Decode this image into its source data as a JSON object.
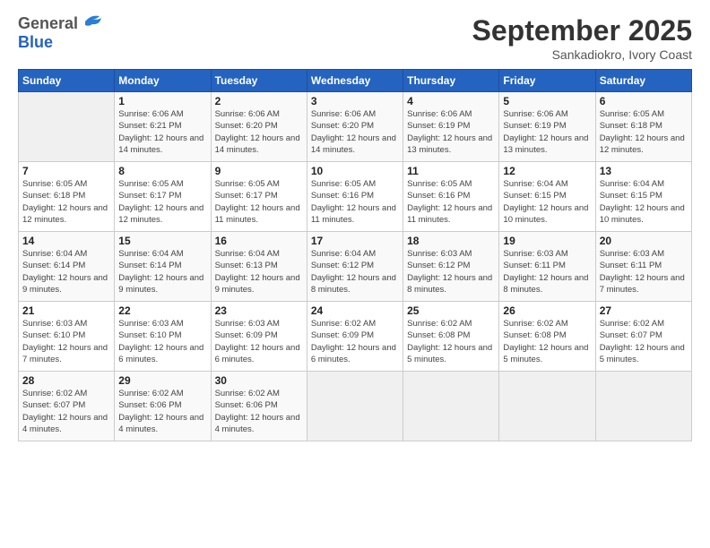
{
  "logo": {
    "line1": "General",
    "line2": "Blue"
  },
  "title": "September 2025",
  "location": "Sankadiokro, Ivory Coast",
  "days_header": [
    "Sunday",
    "Monday",
    "Tuesday",
    "Wednesday",
    "Thursday",
    "Friday",
    "Saturday"
  ],
  "weeks": [
    [
      {
        "day": "",
        "sunrise": "",
        "sunset": "",
        "daylight": ""
      },
      {
        "day": "1",
        "sunrise": "Sunrise: 6:06 AM",
        "sunset": "Sunset: 6:21 PM",
        "daylight": "Daylight: 12 hours and 14 minutes."
      },
      {
        "day": "2",
        "sunrise": "Sunrise: 6:06 AM",
        "sunset": "Sunset: 6:20 PM",
        "daylight": "Daylight: 12 hours and 14 minutes."
      },
      {
        "day": "3",
        "sunrise": "Sunrise: 6:06 AM",
        "sunset": "Sunset: 6:20 PM",
        "daylight": "Daylight: 12 hours and 14 minutes."
      },
      {
        "day": "4",
        "sunrise": "Sunrise: 6:06 AM",
        "sunset": "Sunset: 6:19 PM",
        "daylight": "Daylight: 12 hours and 13 minutes."
      },
      {
        "day": "5",
        "sunrise": "Sunrise: 6:06 AM",
        "sunset": "Sunset: 6:19 PM",
        "daylight": "Daylight: 12 hours and 13 minutes."
      },
      {
        "day": "6",
        "sunrise": "Sunrise: 6:05 AM",
        "sunset": "Sunset: 6:18 PM",
        "daylight": "Daylight: 12 hours and 12 minutes."
      }
    ],
    [
      {
        "day": "7",
        "sunrise": "Sunrise: 6:05 AM",
        "sunset": "Sunset: 6:18 PM",
        "daylight": "Daylight: 12 hours and 12 minutes."
      },
      {
        "day": "8",
        "sunrise": "Sunrise: 6:05 AM",
        "sunset": "Sunset: 6:17 PM",
        "daylight": "Daylight: 12 hours and 12 minutes."
      },
      {
        "day": "9",
        "sunrise": "Sunrise: 6:05 AM",
        "sunset": "Sunset: 6:17 PM",
        "daylight": "Daylight: 12 hours and 11 minutes."
      },
      {
        "day": "10",
        "sunrise": "Sunrise: 6:05 AM",
        "sunset": "Sunset: 6:16 PM",
        "daylight": "Daylight: 12 hours and 11 minutes."
      },
      {
        "day": "11",
        "sunrise": "Sunrise: 6:05 AM",
        "sunset": "Sunset: 6:16 PM",
        "daylight": "Daylight: 12 hours and 11 minutes."
      },
      {
        "day": "12",
        "sunrise": "Sunrise: 6:04 AM",
        "sunset": "Sunset: 6:15 PM",
        "daylight": "Daylight: 12 hours and 10 minutes."
      },
      {
        "day": "13",
        "sunrise": "Sunrise: 6:04 AM",
        "sunset": "Sunset: 6:15 PM",
        "daylight": "Daylight: 12 hours and 10 minutes."
      }
    ],
    [
      {
        "day": "14",
        "sunrise": "Sunrise: 6:04 AM",
        "sunset": "Sunset: 6:14 PM",
        "daylight": "Daylight: 12 hours and 9 minutes."
      },
      {
        "day": "15",
        "sunrise": "Sunrise: 6:04 AM",
        "sunset": "Sunset: 6:14 PM",
        "daylight": "Daylight: 12 hours and 9 minutes."
      },
      {
        "day": "16",
        "sunrise": "Sunrise: 6:04 AM",
        "sunset": "Sunset: 6:13 PM",
        "daylight": "Daylight: 12 hours and 9 minutes."
      },
      {
        "day": "17",
        "sunrise": "Sunrise: 6:04 AM",
        "sunset": "Sunset: 6:12 PM",
        "daylight": "Daylight: 12 hours and 8 minutes."
      },
      {
        "day": "18",
        "sunrise": "Sunrise: 6:03 AM",
        "sunset": "Sunset: 6:12 PM",
        "daylight": "Daylight: 12 hours and 8 minutes."
      },
      {
        "day": "19",
        "sunrise": "Sunrise: 6:03 AM",
        "sunset": "Sunset: 6:11 PM",
        "daylight": "Daylight: 12 hours and 8 minutes."
      },
      {
        "day": "20",
        "sunrise": "Sunrise: 6:03 AM",
        "sunset": "Sunset: 6:11 PM",
        "daylight": "Daylight: 12 hours and 7 minutes."
      }
    ],
    [
      {
        "day": "21",
        "sunrise": "Sunrise: 6:03 AM",
        "sunset": "Sunset: 6:10 PM",
        "daylight": "Daylight: 12 hours and 7 minutes."
      },
      {
        "day": "22",
        "sunrise": "Sunrise: 6:03 AM",
        "sunset": "Sunset: 6:10 PM",
        "daylight": "Daylight: 12 hours and 6 minutes."
      },
      {
        "day": "23",
        "sunrise": "Sunrise: 6:03 AM",
        "sunset": "Sunset: 6:09 PM",
        "daylight": "Daylight: 12 hours and 6 minutes."
      },
      {
        "day": "24",
        "sunrise": "Sunrise: 6:02 AM",
        "sunset": "Sunset: 6:09 PM",
        "daylight": "Daylight: 12 hours and 6 minutes."
      },
      {
        "day": "25",
        "sunrise": "Sunrise: 6:02 AM",
        "sunset": "Sunset: 6:08 PM",
        "daylight": "Daylight: 12 hours and 5 minutes."
      },
      {
        "day": "26",
        "sunrise": "Sunrise: 6:02 AM",
        "sunset": "Sunset: 6:08 PM",
        "daylight": "Daylight: 12 hours and 5 minutes."
      },
      {
        "day": "27",
        "sunrise": "Sunrise: 6:02 AM",
        "sunset": "Sunset: 6:07 PM",
        "daylight": "Daylight: 12 hours and 5 minutes."
      }
    ],
    [
      {
        "day": "28",
        "sunrise": "Sunrise: 6:02 AM",
        "sunset": "Sunset: 6:07 PM",
        "daylight": "Daylight: 12 hours and 4 minutes."
      },
      {
        "day": "29",
        "sunrise": "Sunrise: 6:02 AM",
        "sunset": "Sunset: 6:06 PM",
        "daylight": "Daylight: 12 hours and 4 minutes."
      },
      {
        "day": "30",
        "sunrise": "Sunrise: 6:02 AM",
        "sunset": "Sunset: 6:06 PM",
        "daylight": "Daylight: 12 hours and 4 minutes."
      },
      {
        "day": "",
        "sunrise": "",
        "sunset": "",
        "daylight": ""
      },
      {
        "day": "",
        "sunrise": "",
        "sunset": "",
        "daylight": ""
      },
      {
        "day": "",
        "sunrise": "",
        "sunset": "",
        "daylight": ""
      },
      {
        "day": "",
        "sunrise": "",
        "sunset": "",
        "daylight": ""
      }
    ]
  ]
}
